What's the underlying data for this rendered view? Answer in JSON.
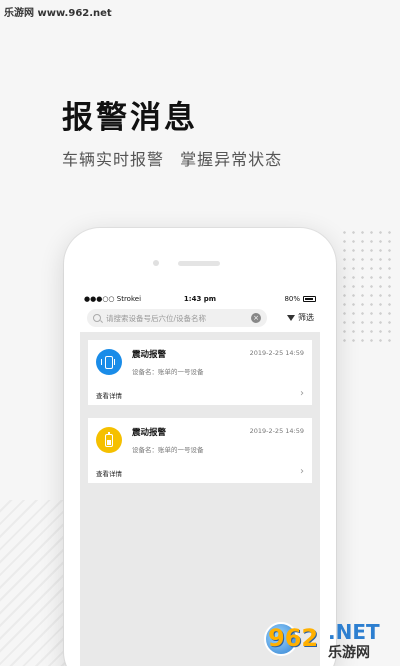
{
  "watermark_top": "乐游网 www.962.net",
  "hero": {
    "title": "报警消息",
    "subtitle": "车辆实时报警 掌握异常状态"
  },
  "status_bar": {
    "carrier": "●●●○○ Strokei",
    "time": "1:43 pm",
    "battery": "80%"
  },
  "search": {
    "placeholder": "请搜索设备号后六位/设备名称",
    "filter_label": "筛选"
  },
  "alerts": [
    {
      "title": "震动报警",
      "time": "2019-2-25 14:59",
      "device": "设备名：账单的一号设备",
      "link": "查看详情",
      "icon": "vibration-icon",
      "icon_color": "#1a8ce8"
    },
    {
      "title": "震动报警",
      "time": "2019-2-25 14:59",
      "device": "设备名：账单的一号设备",
      "link": "查看详情",
      "icon": "battery-icon",
      "icon_color": "#f5c000"
    }
  ],
  "watermark_bottom": {
    "num": "962",
    "net": ".NET",
    "site": "乐游网"
  }
}
